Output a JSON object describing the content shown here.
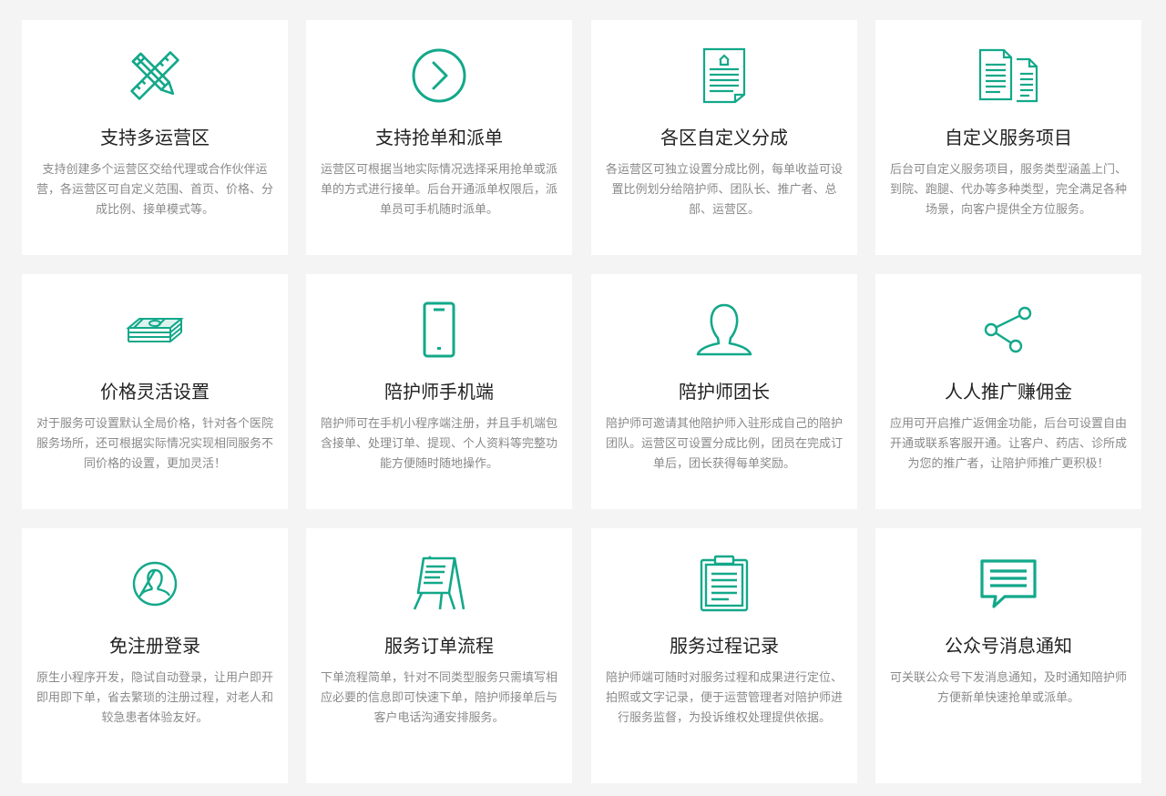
{
  "accent_color": "#13a88a",
  "features": [
    {
      "icon": "ruler-pencil-icon",
      "title": "支持多运营区",
      "desc": "支持创建多个运营区交给代理或合作伙伴运营，各运营区可自定义范围、首页、价格、分成比例、接单模式等。"
    },
    {
      "icon": "arrow-circle-icon",
      "title": "支持抢单和派单",
      "desc": "运营区可根据当地实际情况选择采用抢单或派单的方式进行接单。后台开通派单权限后，派单员可手机随时派单。"
    },
    {
      "icon": "document-icon",
      "title": "各区自定义分成",
      "desc": "各运营区可独立设置分成比例，每单收益可设置比例划分给陪护师、团队长、推广者、总部、运营区。"
    },
    {
      "icon": "documents-icon",
      "title": "自定义服务项目",
      "desc": "后台可自定义服务项目，服务类型涵盖上门、到院、跑腿、代办等多种类型，完全满足各种场景，向客户提供全方位服务。"
    },
    {
      "icon": "money-stack-icon",
      "title": "价格灵活设置",
      "desc": "对于服务可设置默认全局价格，针对各个医院服务场所，还可根据实际情况实现相同服务不同价格的设置，更加灵活！"
    },
    {
      "icon": "mobile-phone-icon",
      "title": "陪护师手机端",
      "desc": "陪护师可在手机小程序端注册，并且手机端包含接单、处理订单、提现、个人资料等完整功能方便随时随地操作。"
    },
    {
      "icon": "person-icon",
      "title": "陪护师团长",
      "desc": "陪护师可邀请其他陪护师入驻形成自己的陪护团队。运营区可设置分成比例，团员在完成订单后，团长获得每单奖励。"
    },
    {
      "icon": "share-icon",
      "title": "人人推广赚佣金",
      "desc": "应用可开启推广返佣金功能，后台可设置自由开通或联系客服开通。让客户、药店、诊所成为您的推广者，让陪护师推广更积极！"
    },
    {
      "icon": "user-circle-icon",
      "title": "免注册登录",
      "desc": "原生小程序开发，隐试自动登录，让用户即开即用即下单，省去繁琐的注册过程，对老人和较急患者体验友好。"
    },
    {
      "icon": "easel-icon",
      "title": "服务订单流程",
      "desc": "下单流程简单，针对不同类型服务只需填写相应必要的信息即可快速下单，陪护师接单后与客户电话沟通安排服务。"
    },
    {
      "icon": "clipboard-icon",
      "title": "服务过程记录",
      "desc": "陪护师端可随时对服务过程和成果进行定位、拍照或文字记录，便于运营管理者对陪护师进行服务监督，为投诉维权处理提供依据。"
    },
    {
      "icon": "message-bubble-icon",
      "title": "公众号消息通知",
      "desc": "可关联公众号下发消息通知，及时通知陪护师方便新单快速抢单或派单。"
    }
  ]
}
